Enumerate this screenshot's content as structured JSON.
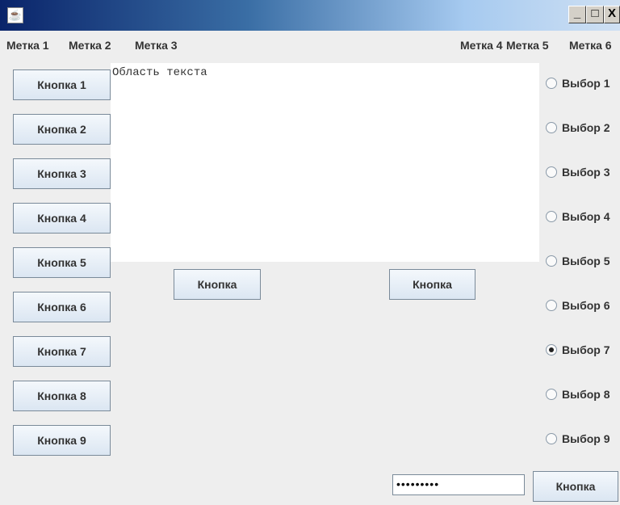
{
  "window": {
    "app_icon": "java-icon",
    "minimize": "_",
    "maximize": "□",
    "close": "X"
  },
  "labels": [
    "Метка 1",
    "Метка 2",
    "Метка 3",
    "Метка 4",
    "Метка 5",
    "Метка 6"
  ],
  "buttons_left": [
    "Кнопка 1",
    "Кнопка 2",
    "Кнопка 3",
    "Кнопка 4",
    "Кнопка 5",
    "Кнопка 6",
    "Кнопка 7",
    "Кнопка 8",
    "Кнопка 9"
  ],
  "text_area": {
    "value": "Область текста"
  },
  "center_buttons": [
    "Кнопка",
    "Кнопка"
  ],
  "radios": {
    "options": [
      "Выбор 1",
      "Выбор 2",
      "Выбор 3",
      "Выбор 4",
      "Выбор 5",
      "Выбор 6",
      "Выбор 7",
      "Выбор 8",
      "Выбор 9"
    ],
    "selected": "Выбор 7"
  },
  "password_field": {
    "value": "•••••••••"
  },
  "bottom_button": "Кнопка"
}
